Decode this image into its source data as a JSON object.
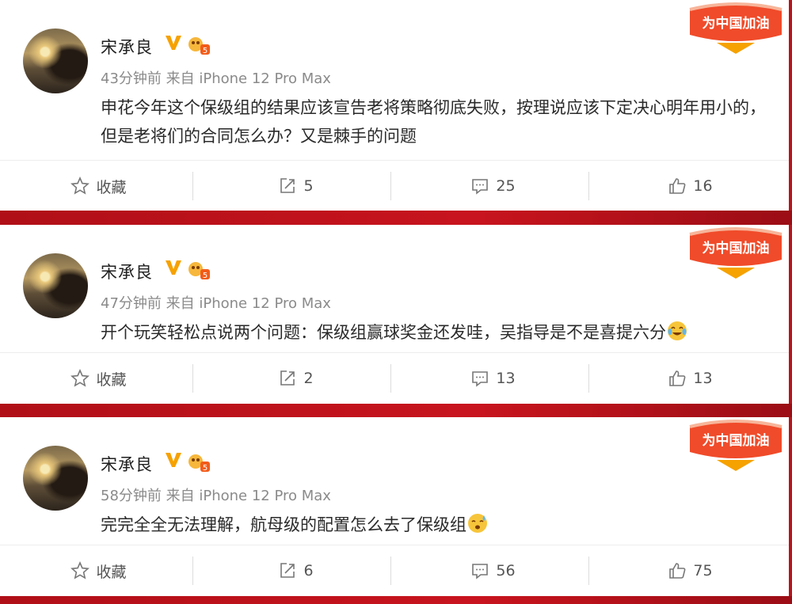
{
  "posts": [
    {
      "author": "宋承良",
      "time": "43分钟前",
      "source": "来自 iPhone 12 Pro Max",
      "text": "申花今年这个保级组的结果应该宣告老将策略彻底失败，按理说应该下定决心明年用小的，但是老将们的合同怎么办？又是棘手的问题",
      "emoji": "",
      "actions": {
        "favorite": "收藏",
        "repost": "5",
        "comment": "25",
        "like": "16"
      }
    },
    {
      "author": "宋承良",
      "time": "47分钟前",
      "source": "来自 iPhone 12 Pro Max",
      "text": "开个玩笑轻松点说两个问题：保级组赢球奖金还发哇，吴指导是不是喜提六分",
      "emoji": "laugh-cry-emoji",
      "actions": {
        "favorite": "收藏",
        "repost": "2",
        "comment": "13",
        "like": "13"
      }
    },
    {
      "author": "宋承良",
      "time": "58分钟前",
      "source": "来自 iPhone 12 Pro Max",
      "text": "完完全全无法理解，航母级的配置怎么去了保级组",
      "emoji": "sweat-emoji",
      "actions": {
        "favorite": "收藏",
        "repost": "6",
        "comment": "56",
        "like": "75"
      }
    }
  ],
  "sticker_text": "为中国加油",
  "colors": {
    "background_red": "#b8141c",
    "verified_orange": "#f6a200",
    "text_dark": "#2a2a2a",
    "meta_gray": "#8a8a8a"
  },
  "icons": [
    "star-icon",
    "repost-icon",
    "comment-icon",
    "like-icon",
    "verified-v-icon",
    "user-level-icon"
  ]
}
